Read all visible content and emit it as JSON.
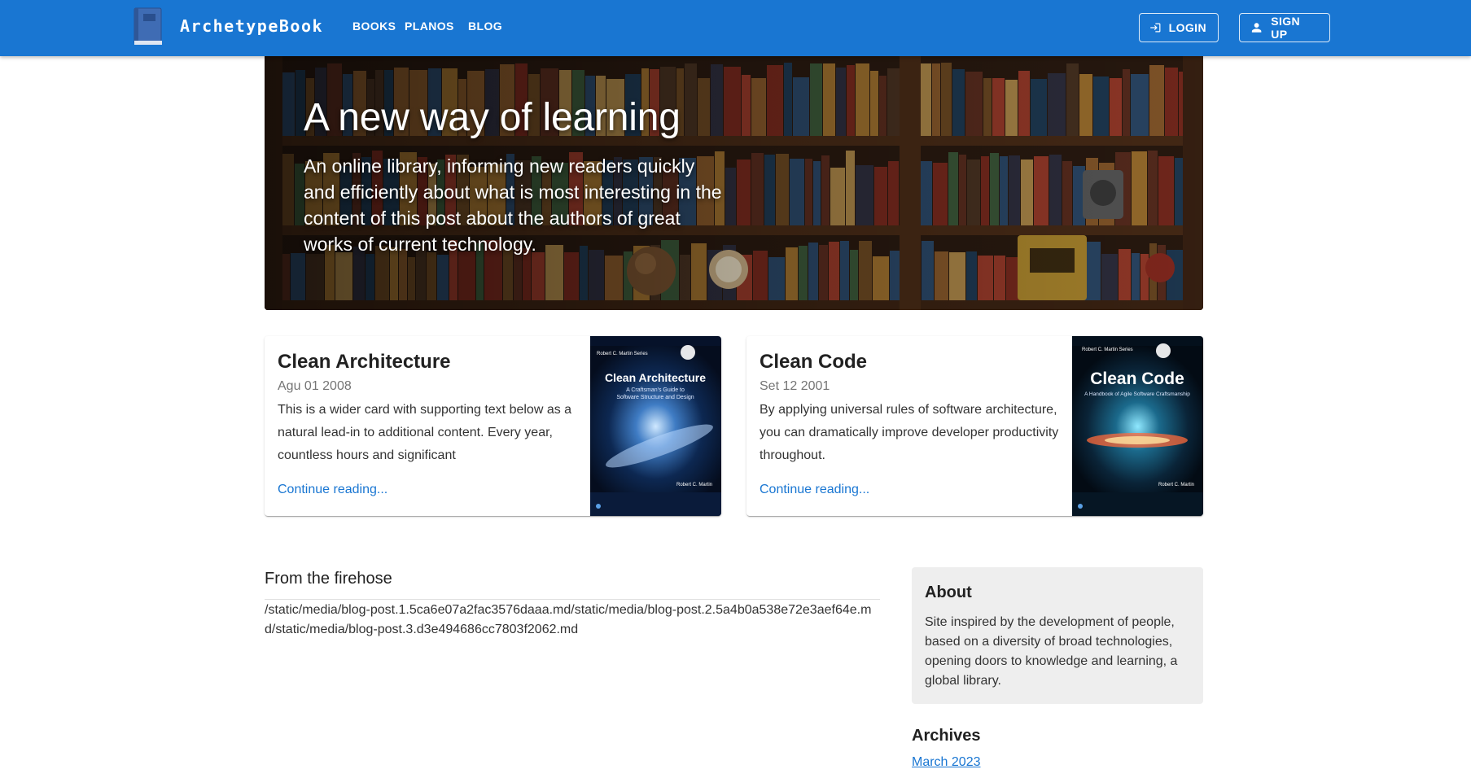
{
  "header": {
    "brand": "ArchetypeBook",
    "nav": [
      {
        "label": "BOOKS"
      },
      {
        "label": "PLANOS"
      },
      {
        "label": "BLOG"
      }
    ],
    "login_label": "LOGIN",
    "signup_label": "SIGN UP",
    "bar_color": "#1976d2"
  },
  "hero": {
    "title": "A new way of learning",
    "description": "An online library, informing new readers quickly and efficiently about what is most interesting in the content of this post about the authors of great works of current technology."
  },
  "featured": [
    {
      "title": "Clean Architecture",
      "date": "Agu 01 2008",
      "description": "This is a wider card with supporting text below as a natural lead-in to additional content. Every year, countless hours and significant",
      "link": "Continue reading...",
      "cover": {
        "series": "Robert C. Martin Series",
        "title": "Clean Architecture",
        "subtitle_1": "A Craftsman's Guide to",
        "subtitle_2": "Software Structure and Design",
        "author": "Robert C. Martin"
      }
    },
    {
      "title": "Clean Code",
      "date": "Set 12 2001",
      "description": "By applying universal rules of software architecture, you can dramatically improve developer productivity throughout.",
      "link": "Continue reading...",
      "cover": {
        "series": "Robert C. Martin Series",
        "title": "Clean Code",
        "subtitle_1": "A Handbook of Agile Software Craftsmanship",
        "author": "Robert C. Martin"
      }
    }
  ],
  "main": {
    "section_title": "From the firehose",
    "posts_text": "/static/media/blog-post.1.5ca6e07a2fac3576daaa.md/static/media/blog-post.2.5a4b0a538e72e3aef64e.md/static/media/blog-post.3.d3e494686cc7803f2062.md"
  },
  "sidebar": {
    "about_title": "About",
    "about_text": "Site inspired by the development of people, based on a diversity of broad technologies, opening doors to knowledge and learning, a global library.",
    "archives_title": "Archives",
    "archives": [
      {
        "label": "March 2023"
      }
    ]
  }
}
